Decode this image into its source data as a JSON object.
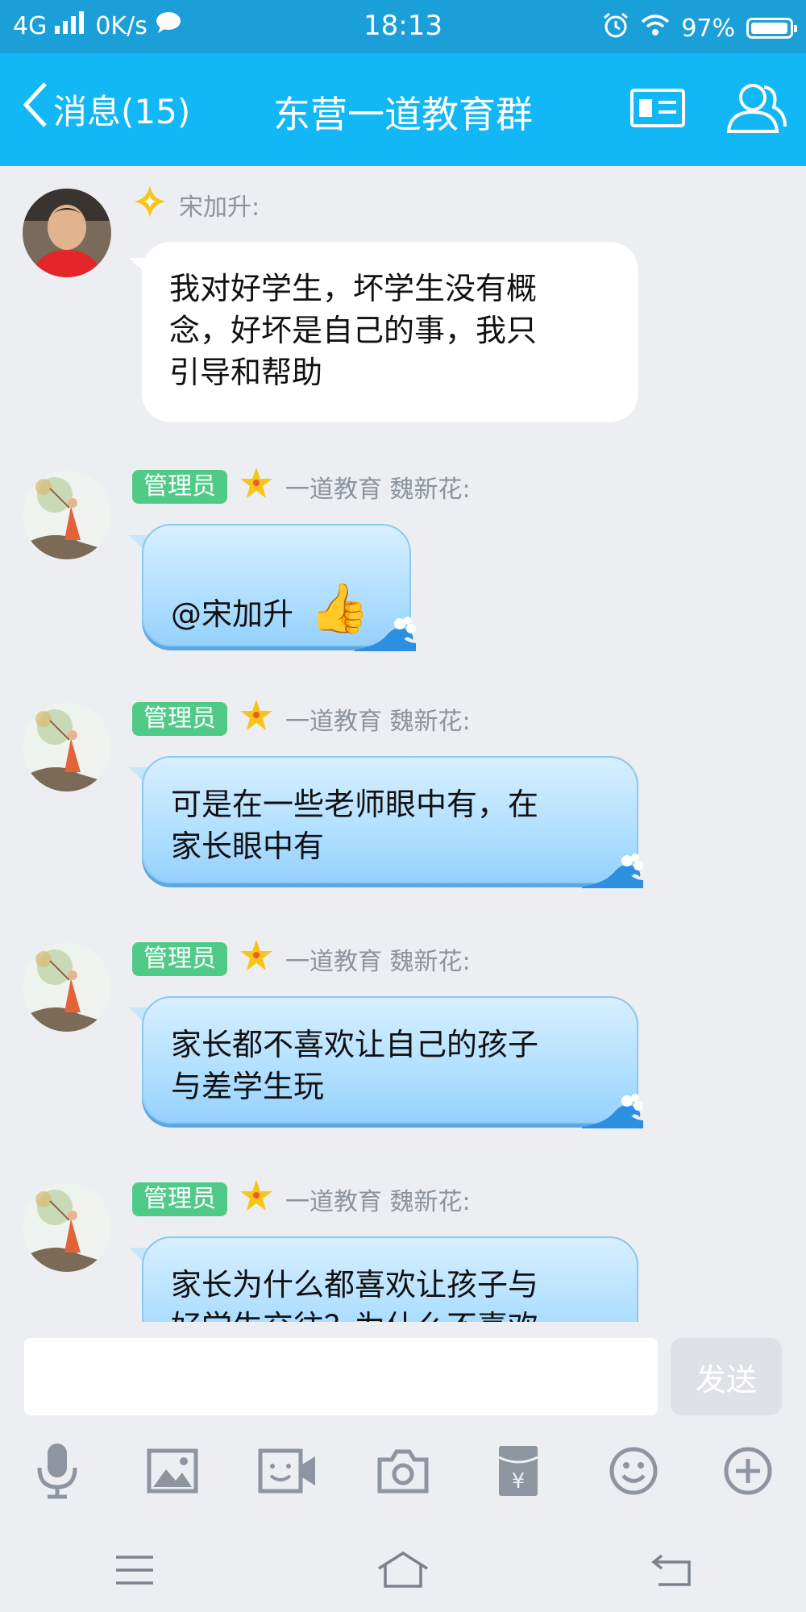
{
  "status_bar": {
    "network": "4G",
    "speed": "0K/s",
    "time": "18:13",
    "battery": "97%",
    "battery_level": 0.97,
    "icons": [
      "signal-icon",
      "chat-notification-icon",
      "alarm-icon",
      "wifi-icon",
      "battery-icon"
    ]
  },
  "header": {
    "back_label": "消息(15)",
    "title": "东营一道教育群",
    "actions": [
      "group-card-icon",
      "group-members-icon"
    ]
  },
  "messages": [
    {
      "sender": "宋加升:",
      "level_icon": "sparkle-icon",
      "bubble": "white",
      "text": [
        "我对好学生，坏学生没有概",
        "念，好坏是自己的事，我只",
        "引导和帮助"
      ]
    },
    {
      "badge": "管理员",
      "level_icon": "star-icon",
      "sender": "一道教育 魏新花:",
      "bubble": "blue",
      "text": [
        "",
        "@宋加升"
      ],
      "emoji": "👍"
    },
    {
      "badge": "管理员",
      "level_icon": "star-icon",
      "sender": "一道教育 魏新花:",
      "bubble": "blue",
      "text": [
        "可是在一些老师眼中有，在",
        "家长眼中有"
      ]
    },
    {
      "badge": "管理员",
      "level_icon": "star-icon",
      "sender": "一道教育 魏新花:",
      "bubble": "blue",
      "text": [
        "家长都不喜欢让自己的孩子",
        "与差学生玩"
      ]
    },
    {
      "badge": "管理员",
      "level_icon": "star-icon",
      "sender": "一道教育 魏新花:",
      "bubble": "blue",
      "text": [
        "家长为什么都喜欢让孩子与",
        "好学生交往？为什么不喜欢"
      ]
    }
  ],
  "input": {
    "placeholder": "",
    "send_label": "发送"
  },
  "toolbar": [
    "microphone-icon",
    "image-icon",
    "video-call-icon",
    "camera-icon",
    "red-packet-icon",
    "emoji-icon",
    "plus-icon"
  ],
  "nav": [
    "menu-icon",
    "home-icon",
    "back-icon"
  ],
  "colors": {
    "header": "#12b7f5",
    "status_bar": "#1b9fd8",
    "background": "#eceef2",
    "admin_badge": "#4fcb87",
    "bubble_blue": "#aadcff"
  }
}
